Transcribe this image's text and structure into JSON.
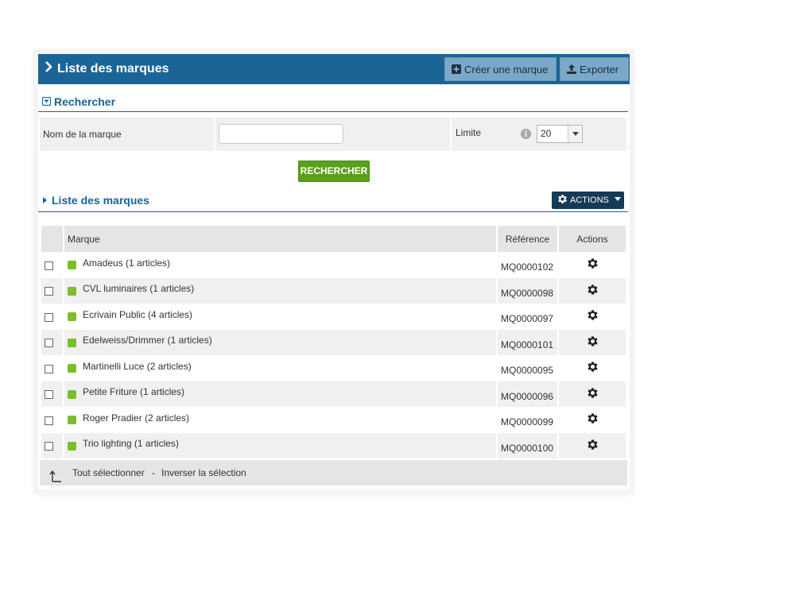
{
  "header": {
    "title": "Liste des marques",
    "create_label": "Créer une marque",
    "export_label": "Exporter"
  },
  "search": {
    "title": "Rechercher",
    "name_label": "Nom de la marque",
    "name_value": "",
    "limit_label": "Limite",
    "limit_value": "20",
    "button_label": "RECHERCHER"
  },
  "list": {
    "title": "Liste des marques",
    "actions_label": "ACTIONS",
    "columns": {
      "brand": "Marque",
      "reference": "Référence",
      "actions": "Actions"
    },
    "rows": [
      {
        "name": "Amadeus (1 articles)",
        "ref": "MQ0000102"
      },
      {
        "name": "CVL luminaires (1 articles)",
        "ref": "MQ0000098"
      },
      {
        "name": "Ecrivain Public (4 articles)",
        "ref": "MQ0000097"
      },
      {
        "name": "Edelweiss/Drimmer (1 articles)",
        "ref": "MQ0000101"
      },
      {
        "name": "Martinelli Luce (2 articles)",
        "ref": "MQ0000095"
      },
      {
        "name": "Petite Friture (1 articles)",
        "ref": "MQ0000096"
      },
      {
        "name": "Roger Pradier (2 articles)",
        "ref": "MQ0000099"
      },
      {
        "name": "Trio lighting (1 articles)",
        "ref": "MQ0000100"
      }
    ]
  },
  "footer": {
    "select_all": "Tout sélectionner",
    "separator": "-",
    "invert": "Inverser la sélection"
  },
  "colors": {
    "header_bg": "#1a6496",
    "header_button_bg": "#7aa8c8",
    "search_button": "#5aa018",
    "actions_button": "#153a57",
    "status_dot": "#7cbd2a"
  },
  "icons": {
    "header": "chevron-right-icon",
    "create": "plus-square-icon",
    "export": "upload-icon",
    "search_section": "collapse-square-icon",
    "list_section": "caret-right-icon",
    "info": "info-icon",
    "row_action": "gear-icon",
    "footer": "arrow-up-corner-icon"
  }
}
